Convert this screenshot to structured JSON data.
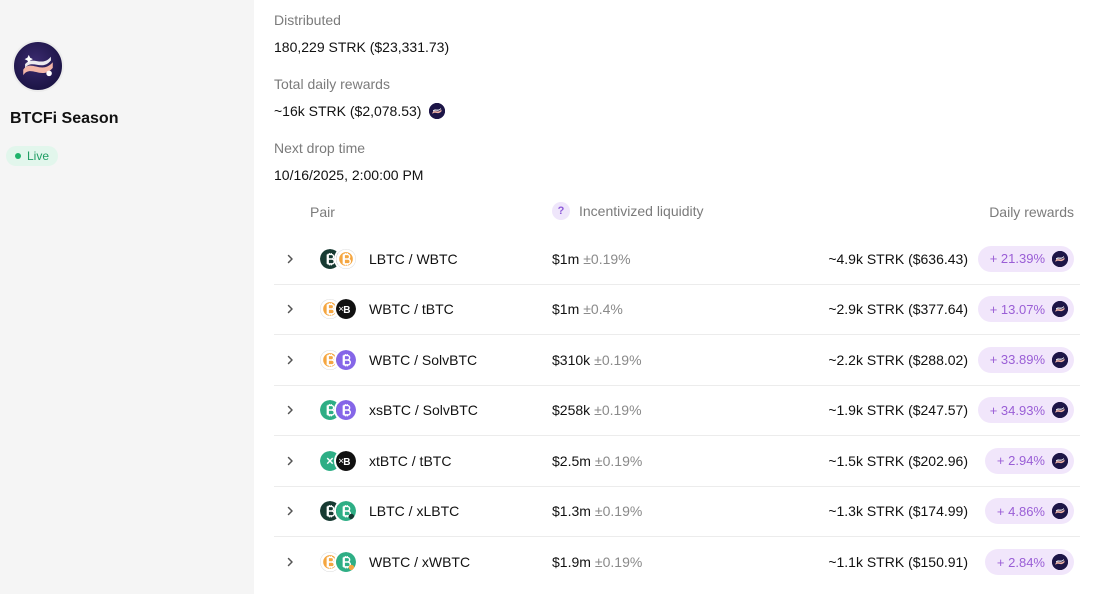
{
  "sidebar": {
    "title": "BTCFi Season",
    "status": "Live"
  },
  "info": {
    "distributed_label": "Distributed",
    "distributed_value": "180,229 STRK ($23,331.73)",
    "daily_label": "Total daily rewards",
    "daily_value": "~16k STRK ($2,078.53)",
    "next_label": "Next drop time",
    "next_value": "10/16/2025, 2:00:00 PM"
  },
  "table": {
    "headers": {
      "pair": "Pair",
      "help": "?",
      "liquidity": "Incentivized liquidity",
      "rewards": "Daily rewards"
    },
    "rows": [
      {
        "pair": "LBTC / WBTC",
        "liq": "$1m",
        "liq_pct": "±0.19%",
        "reward": "~4.9k STRK ($636.43)",
        "apr": "+ 21.39%",
        "tokens": [
          "lbtc",
          "wbtc"
        ]
      },
      {
        "pair": "WBTC / tBTC",
        "liq": "$1m",
        "liq_pct": "±0.4%",
        "reward": "~2.9k STRK ($377.64)",
        "apr": "+ 13.07%",
        "tokens": [
          "wbtc",
          "tbtc"
        ]
      },
      {
        "pair": "WBTC / SolvBTC",
        "liq": "$310k",
        "liq_pct": "±0.19%",
        "reward": "~2.2k STRK ($288.02)",
        "apr": "+ 33.89%",
        "tokens": [
          "wbtc",
          "solvbtc"
        ]
      },
      {
        "pair": "xsBTC / SolvBTC",
        "liq": "$258k",
        "liq_pct": "±0.19%",
        "reward": "~1.9k STRK ($247.57)",
        "apr": "+ 34.93%",
        "tokens": [
          "xsbtc",
          "solvbtc"
        ]
      },
      {
        "pair": "xtBTC / tBTC",
        "liq": "$2.5m",
        "liq_pct": "±0.19%",
        "reward": "~1.5k STRK ($202.96)",
        "apr": "+ 2.94%",
        "tokens": [
          "xtbtc",
          "tbtc"
        ]
      },
      {
        "pair": "LBTC / xLBTC",
        "liq": "$1.3m",
        "liq_pct": "±0.19%",
        "reward": "~1.3k STRK ($174.99)",
        "apr": "+ 4.86%",
        "tokens": [
          "lbtc",
          "xlbtc"
        ]
      },
      {
        "pair": "WBTC / xWBTC",
        "liq": "$1.9m",
        "liq_pct": "±0.19%",
        "reward": "~1.1k STRK ($150.91)",
        "apr": "+ 2.84%",
        "tokens": [
          "wbtc",
          "xwbtc"
        ]
      }
    ]
  },
  "icons": {
    "logo": "starknet-logo-icon",
    "chevron": "chevron-right-icon",
    "strk": "strk-token-icon"
  },
  "colors": {
    "live_green": "#1fb36b",
    "reward_badge_bg": "#f1e6fb",
    "reward_badge_text": "#9a5ed6",
    "sidebar_bg": "#f5f5f5"
  }
}
